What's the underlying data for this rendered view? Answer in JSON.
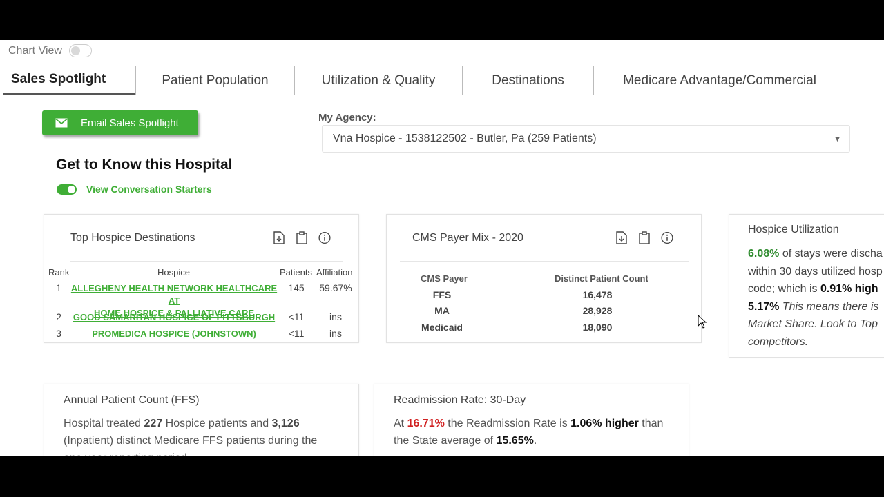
{
  "chart_view": {
    "label": "Chart View"
  },
  "tabs": [
    {
      "label": "Sales Spotlight"
    },
    {
      "label": "Patient Population"
    },
    {
      "label": "Utilization & Quality"
    },
    {
      "label": "Destinations"
    },
    {
      "label": "Medicare Advantage/Commercial"
    }
  ],
  "email_button": {
    "label": "Email Sales Spotlight"
  },
  "agency": {
    "label": "My Agency:",
    "selected": "Vna Hospice - 1538122502 - Butler, Pa (259 Patients)"
  },
  "section_title": "Get to Know this Hospital",
  "conversation_toggle": {
    "label": "View Conversation Starters"
  },
  "top_hospice": {
    "title": "Top Hospice Destinations",
    "columns": [
      "Rank",
      "Hospice",
      "Patients",
      "Affiliation"
    ],
    "rows": [
      {
        "rank": "1",
        "name_line1": "ALLEGHENY HEALTH NETWORK HEALTHCARE AT",
        "name_line2": "HOME HOSPICE & PALLIATIVE CARE",
        "patients": "145",
        "affiliation": "59.67%"
      },
      {
        "rank": "2",
        "name_line1": "GOOD SAMARITAN HOSPICE OF PITTSBURGH",
        "name_line2": "",
        "patients": "<11",
        "affiliation": "ins"
      },
      {
        "rank": "3",
        "name_line1": "PROMEDICA HOSPICE (JOHNSTOWN)",
        "name_line2": "",
        "patients": "<11",
        "affiliation": "ins"
      }
    ]
  },
  "cms_payer": {
    "title": "CMS Payer Mix - 2020",
    "columns": [
      "CMS Payer",
      "Distinct Patient Count"
    ],
    "rows": [
      {
        "payer": "FFS",
        "count": "16,478"
      },
      {
        "payer": "MA",
        "count": "28,928"
      },
      {
        "payer": "Medicaid",
        "count": "18,090"
      }
    ]
  },
  "hospice_utilization": {
    "title": "Hospice Utilization",
    "pct": "6.08%",
    "t1": " of stays were discha",
    "t2": "within 30 days utilized hosp",
    "t3": "code; which is ",
    "higher": "0.91% high",
    "state": "5.17%",
    "t4": " This means there is",
    "t5": "Market Share. Look to Top",
    "t6": "competitors."
  },
  "annual_count": {
    "title": "Annual Patient Count (FFS)",
    "p1": "Hospital treated ",
    "hospice_patients": "227",
    "p2": " Hospice patients and ",
    "inpatients": "3,126",
    "p3": "(Inpatient) distinct Medicare FFS patients during the",
    "p4": "one year reporting period."
  },
  "readmission": {
    "title": "Readmission Rate: 30-Day",
    "p1": "At ",
    "rate": "16.71%",
    "p2": " the Readmission Rate is ",
    "diff": "1.06% higher",
    "p3": " than",
    "p4": "the State average of ",
    "state": "15.65%",
    "p5": "."
  },
  "colors": {
    "accent_green": "#3fae36",
    "red": "#d02020"
  }
}
